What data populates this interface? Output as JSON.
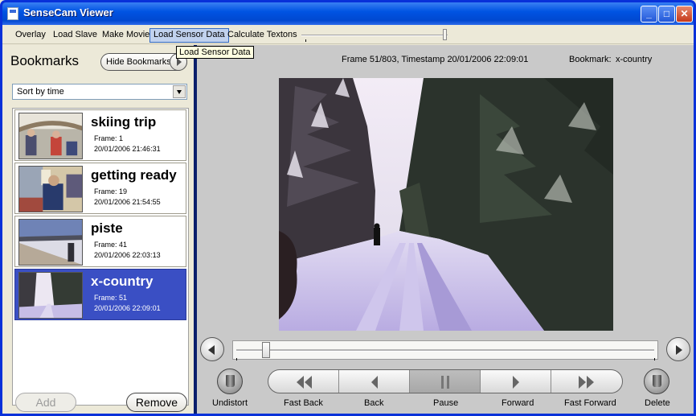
{
  "window": {
    "title": "SenseCam Viewer"
  },
  "menu": {
    "items": [
      {
        "label": "Overlay"
      },
      {
        "label": "Load Slave"
      },
      {
        "label": "Make Movie"
      },
      {
        "label": "Load Sensor Data",
        "active": true
      },
      {
        "label": "Calculate Textons"
      }
    ],
    "slider_value": 1.0
  },
  "tooltip": "Load Sensor Data",
  "sidebar": {
    "heading": "Bookmarks",
    "hide_button": "Hide Bookmarks",
    "sort_value": "Sort by time",
    "bookmarks": [
      {
        "name": "skiing trip",
        "frame": "Frame: 1",
        "time": "20/01/2006 21:46:31",
        "selected": false
      },
      {
        "name": "getting ready",
        "frame": "Frame: 19",
        "time": "20/01/2006 21:54:55",
        "selected": false
      },
      {
        "name": "piste",
        "frame": "Frame: 41",
        "time": "20/01/2006 22:03:13",
        "selected": false
      },
      {
        "name": "x-country",
        "frame": "Frame: 51",
        "time": "20/01/2006 22:09:01",
        "selected": true
      }
    ],
    "add_label": "Add",
    "remove_label": "Remove"
  },
  "viewer": {
    "frame_info": "Frame 51/803, Timestamp 20/01/2006 22:09:01",
    "bookmark_label": "Bookmark:",
    "bookmark_value": "x-country",
    "timeline_position": 0.0625
  },
  "controls": {
    "undistort": "Undistort",
    "fast_back": "Fast Back",
    "back": "Back",
    "pause": "Pause",
    "forward": "Forward",
    "fast_forward": "Fast Forward",
    "delete": "Delete"
  },
  "colors": {
    "selection": "#3a4fc4",
    "titlebar": "#0054e3"
  }
}
